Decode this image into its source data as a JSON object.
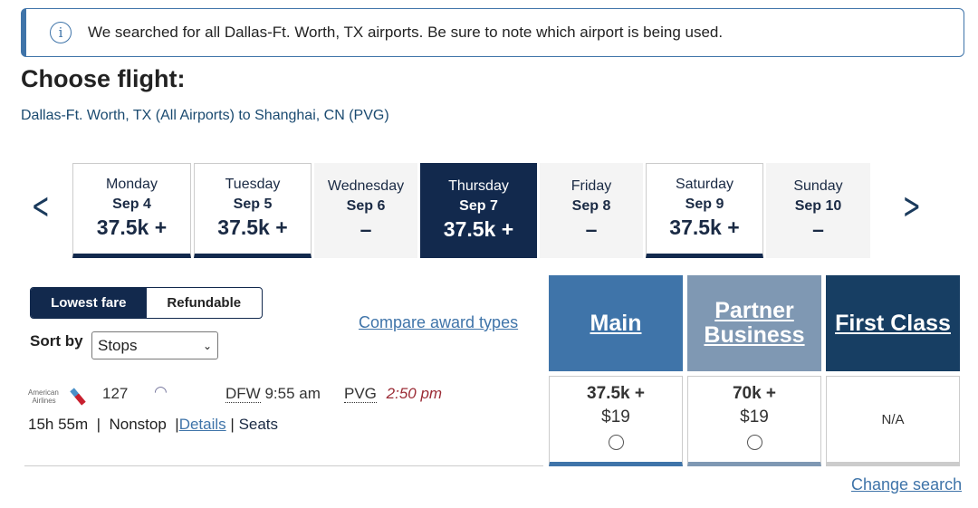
{
  "banner": {
    "icon": "info-icon",
    "text": "We searched for all Dallas-Ft. Worth, TX airports. Be sure to note which airport is being used."
  },
  "title": "Choose flight:",
  "route": "Dallas-Ft. Worth, TX (All Airports) to Shanghai, CN (PVG)",
  "days": [
    {
      "day": "Monday",
      "date": "Sep 4",
      "price": "37.5k +",
      "state": "available"
    },
    {
      "day": "Tuesday",
      "date": "Sep 5",
      "price": "37.5k +",
      "state": "available"
    },
    {
      "day": "Wednesday",
      "date": "Sep 6",
      "price": "–",
      "state": "unavailable"
    },
    {
      "day": "Thursday",
      "date": "Sep 7",
      "price": "37.5k +",
      "state": "selected"
    },
    {
      "day": "Friday",
      "date": "Sep 8",
      "price": "–",
      "state": "unavailable"
    },
    {
      "day": "Saturday",
      "date": "Sep 9",
      "price": "37.5k +",
      "state": "available"
    },
    {
      "day": "Sunday",
      "date": "Sep 10",
      "price": "–",
      "state": "unavailable"
    }
  ],
  "toggle": {
    "lowest": "Lowest fare",
    "refundable": "Refundable",
    "selected": "Lowest fare"
  },
  "sort": {
    "label": "Sort by",
    "value": "Stops"
  },
  "compare": "Compare award types",
  "flight": {
    "airline": "American Airlines",
    "number": "127",
    "wifi_icon": "wifi-icon",
    "origin": "DFW",
    "depart": "9:55 am",
    "dest": "PVG",
    "arrive": "2:50 pm",
    "duration": "15h 55m",
    "sep": "|",
    "stops": "Nonstop",
    "details": "Details",
    "seats": "Seats"
  },
  "fares": [
    {
      "name": "Main",
      "miles": "37.5k +",
      "fee": "$19",
      "color": "#3f74a9"
    },
    {
      "name": "Partner Business",
      "miles": "70k +",
      "fee": "$19",
      "color": "#7f98b3"
    },
    {
      "name": "First Class",
      "na": "N/A",
      "color": "#173e63"
    }
  ],
  "change_search": "Change search"
}
